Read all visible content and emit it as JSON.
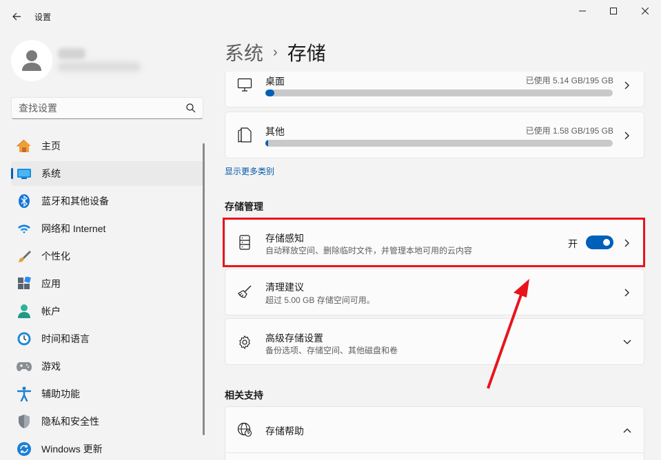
{
  "window": {
    "title": "设置",
    "back_icon": "back-arrow-icon",
    "minimize_icon": "minimize-icon",
    "maximize_icon": "maximize-icon",
    "close_icon": "close-icon"
  },
  "search": {
    "placeholder": "查找设置",
    "icon": "search-icon"
  },
  "sidebar": {
    "items": [
      {
        "label": "主页",
        "icon": "home-icon",
        "active": false
      },
      {
        "label": "系统",
        "icon": "system-icon",
        "active": true
      },
      {
        "label": "蓝牙和其他设备",
        "icon": "bluetooth-icon",
        "active": false
      },
      {
        "label": "网络和 Internet",
        "icon": "wifi-icon",
        "active": false
      },
      {
        "label": "个性化",
        "icon": "brush-icon",
        "active": false
      },
      {
        "label": "应用",
        "icon": "apps-icon",
        "active": false
      },
      {
        "label": "帐户",
        "icon": "account-icon",
        "active": false
      },
      {
        "label": "时间和语言",
        "icon": "clock-globe-icon",
        "active": false
      },
      {
        "label": "游戏",
        "icon": "gamepad-icon",
        "active": false
      },
      {
        "label": "辅助功能",
        "icon": "accessibility-icon",
        "active": false
      },
      {
        "label": "隐私和安全性",
        "icon": "shield-icon",
        "active": false
      },
      {
        "label": "Windows 更新",
        "icon": "update-icon",
        "active": false
      }
    ]
  },
  "breadcrumb": {
    "parent": "系统",
    "separator": "›",
    "current": "存储"
  },
  "storage_categories": [
    {
      "name": "桌面",
      "usage": "已使用 5.14 GB/195 GB",
      "used_fraction": 0.026,
      "icon": "monitor-icon"
    },
    {
      "name": "其他",
      "usage": "已使用 1.58 GB/195 GB",
      "used_fraction": 0.008,
      "icon": "other-files-icon"
    }
  ],
  "show_more_link": "显示更多类别",
  "storage_management": {
    "title": "存储管理",
    "storage_sense": {
      "title": "存储感知",
      "subtitle": "自动释放空间、删除临时文件，并管理本地可用的云内容",
      "toggle_label": "开",
      "toggle_on": true,
      "icon": "storage-drive-icon"
    },
    "cleanup": {
      "title": "清理建议",
      "subtitle": "超过 5.00 GB 存储空间可用。",
      "icon": "broom-icon"
    },
    "advanced": {
      "title": "高级存储设置",
      "subtitle": "备份选项、存储空间、其他磁盘和卷",
      "icon": "gear-icon"
    }
  },
  "related_support": {
    "title": "相关支持",
    "help": {
      "title": "存储帮助",
      "icon": "globe-help-icon"
    }
  },
  "colors": {
    "accent": "#005fb8",
    "annotation_red": "#e8141a"
  }
}
